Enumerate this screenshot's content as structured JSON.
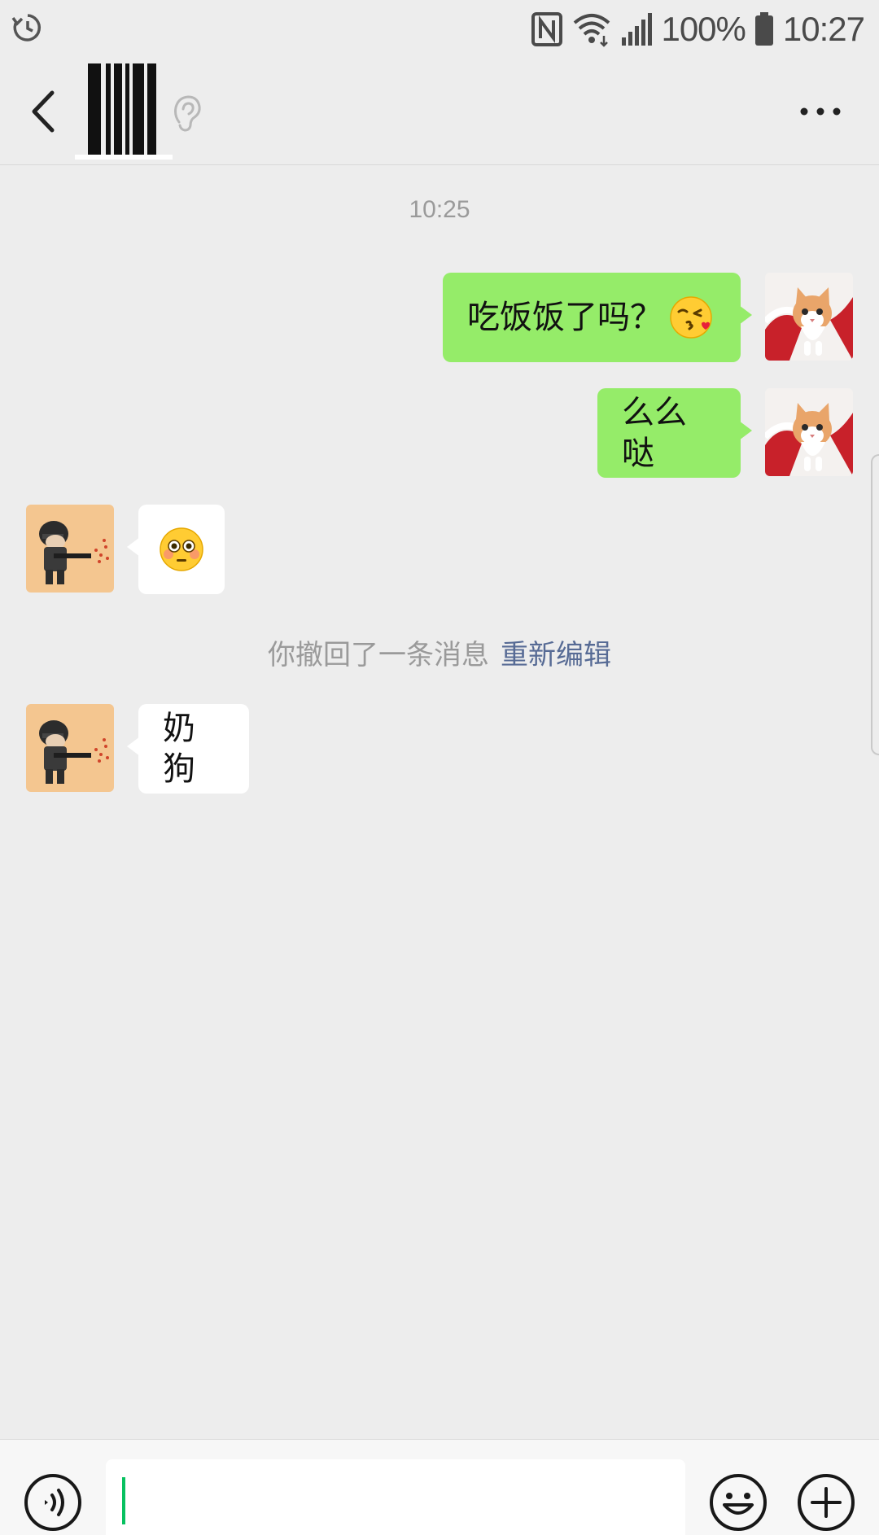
{
  "status_bar": {
    "battery_percent": "100%",
    "time": "10:27",
    "icons": [
      "history-icon",
      "nfc-icon",
      "wifi-icon",
      "signal-icon",
      "battery-icon"
    ]
  },
  "title_bar": {
    "contact_name": "",
    "icons": [
      "back-icon",
      "ear-icon",
      "more-icon"
    ]
  },
  "chat": {
    "timestamp": "10:25",
    "messages": [
      {
        "sender": "me",
        "text": "吃饭饭了吗？",
        "emoji": "kissing-face-icon"
      },
      {
        "sender": "me",
        "text": "么么哒"
      },
      {
        "sender": "other",
        "text": "",
        "emoji": "flushed-face-icon"
      },
      {
        "sender": "other",
        "text": "奶狗"
      }
    ],
    "recall_notice": {
      "text": "你撤回了一条消息",
      "action": "重新编辑"
    }
  },
  "input_bar": {
    "value": "",
    "icons": [
      "voice-icon",
      "emoji-icon",
      "plus-icon"
    ]
  },
  "colors": {
    "background": "#ededed",
    "my_bubble": "#95ec69",
    "their_bubble": "#ffffff",
    "link": "#576b95",
    "cursor": "#07c160"
  }
}
